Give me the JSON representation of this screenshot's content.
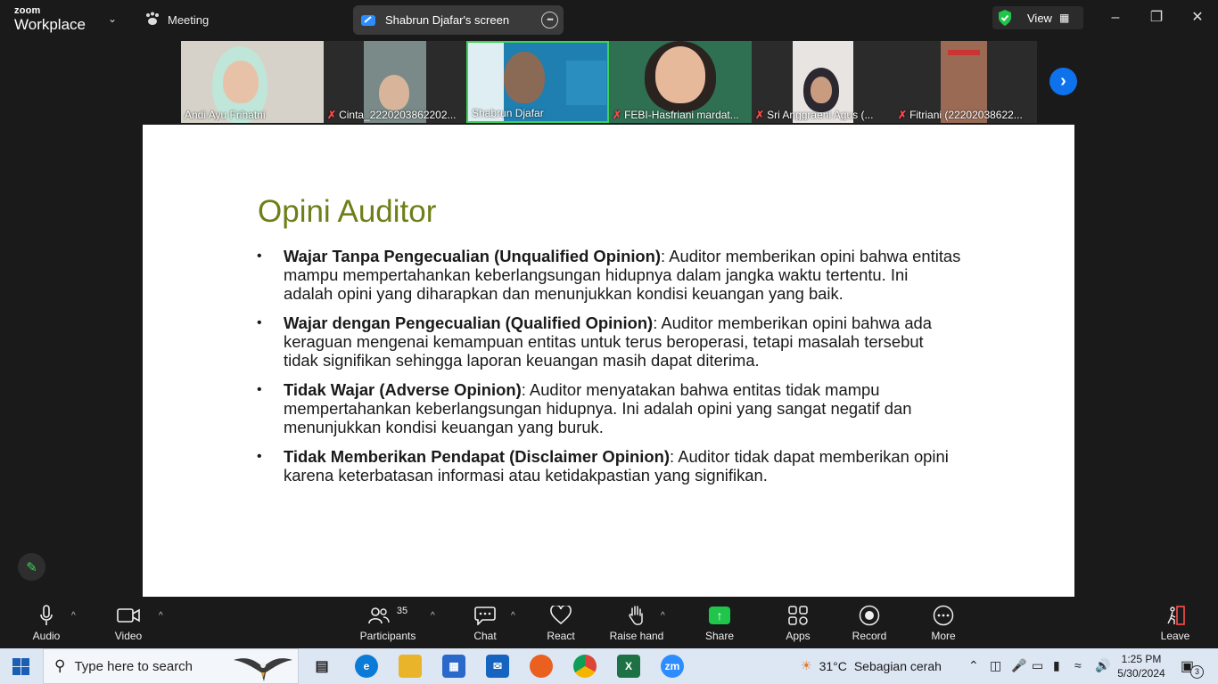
{
  "app": {
    "logo_line1": "zoom",
    "logo_line2": "Workplace"
  },
  "header": {
    "meeting_label": "Meeting",
    "share_title": "Shabrun Djafar's screen",
    "view_label": "View"
  },
  "gallery": {
    "participants": [
      {
        "name": "Andi Ayu Frihatni",
        "muted": false
      },
      {
        "name": "Cinta_2220203862202...",
        "muted": true
      },
      {
        "name": "Shabrun Djafar",
        "muted": false,
        "active": true
      },
      {
        "name": "FEBI-Hasfriani mardat...",
        "muted": true
      },
      {
        "name": "Sri Anggraeni Agus (...",
        "muted": true
      },
      {
        "name": "Fitriani (22202038622...",
        "muted": true
      }
    ]
  },
  "slide": {
    "title": "Opini Auditor",
    "bullets": [
      {
        "bold": "Wajar Tanpa Pengecualian (Unqualified Opinion)",
        "text": ": Auditor memberikan opini bahwa entitas mampu mempertahankan keberlangsungan hidupnya dalam jangka waktu tertentu. Ini adalah opini yang diharapkan dan menunjukkan kondisi keuangan yang baik."
      },
      {
        "bold": "Wajar dengan Pengecualian (Qualified Opinion)",
        "text": ": Auditor memberikan opini bahwa ada keraguan mengenai kemampuan entitas untuk terus beroperasi, tetapi masalah tersebut tidak signifikan sehingga laporan keuangan masih dapat diterima."
      },
      {
        "bold": "Tidak Wajar (Adverse Opinion)",
        "text": ": Auditor menyatakan bahwa entitas tidak mampu mempertahankan keberlangsungan hidupnya. Ini adalah opini yang sangat negatif dan menunjukkan kondisi keuangan yang buruk."
      },
      {
        "bold": "Tidak Memberikan Pendapat (Disclaimer Opinion)",
        "text": ": Auditor tidak dapat memberikan opini karena keterbatasan informasi atau ketidakpastian yang signifikan."
      }
    ]
  },
  "toolbar": {
    "audio": "Audio",
    "video": "Video",
    "participants": "Participants",
    "participants_count": "35",
    "chat": "Chat",
    "react": "React",
    "raise_hand": "Raise hand",
    "share": "Share",
    "apps": "Apps",
    "record": "Record",
    "more": "More",
    "leave": "Leave"
  },
  "taskbar": {
    "search_placeholder": "Type here to search",
    "temperature": "31°C",
    "weather": "Sebagian cerah",
    "time": "1:25 PM",
    "date": "5/30/2024",
    "notification_count": "3"
  },
  "colors": {
    "accent_green": "#3cd25a",
    "zoom_blue": "#0e72ed",
    "slide_title": "#6d7f18"
  }
}
